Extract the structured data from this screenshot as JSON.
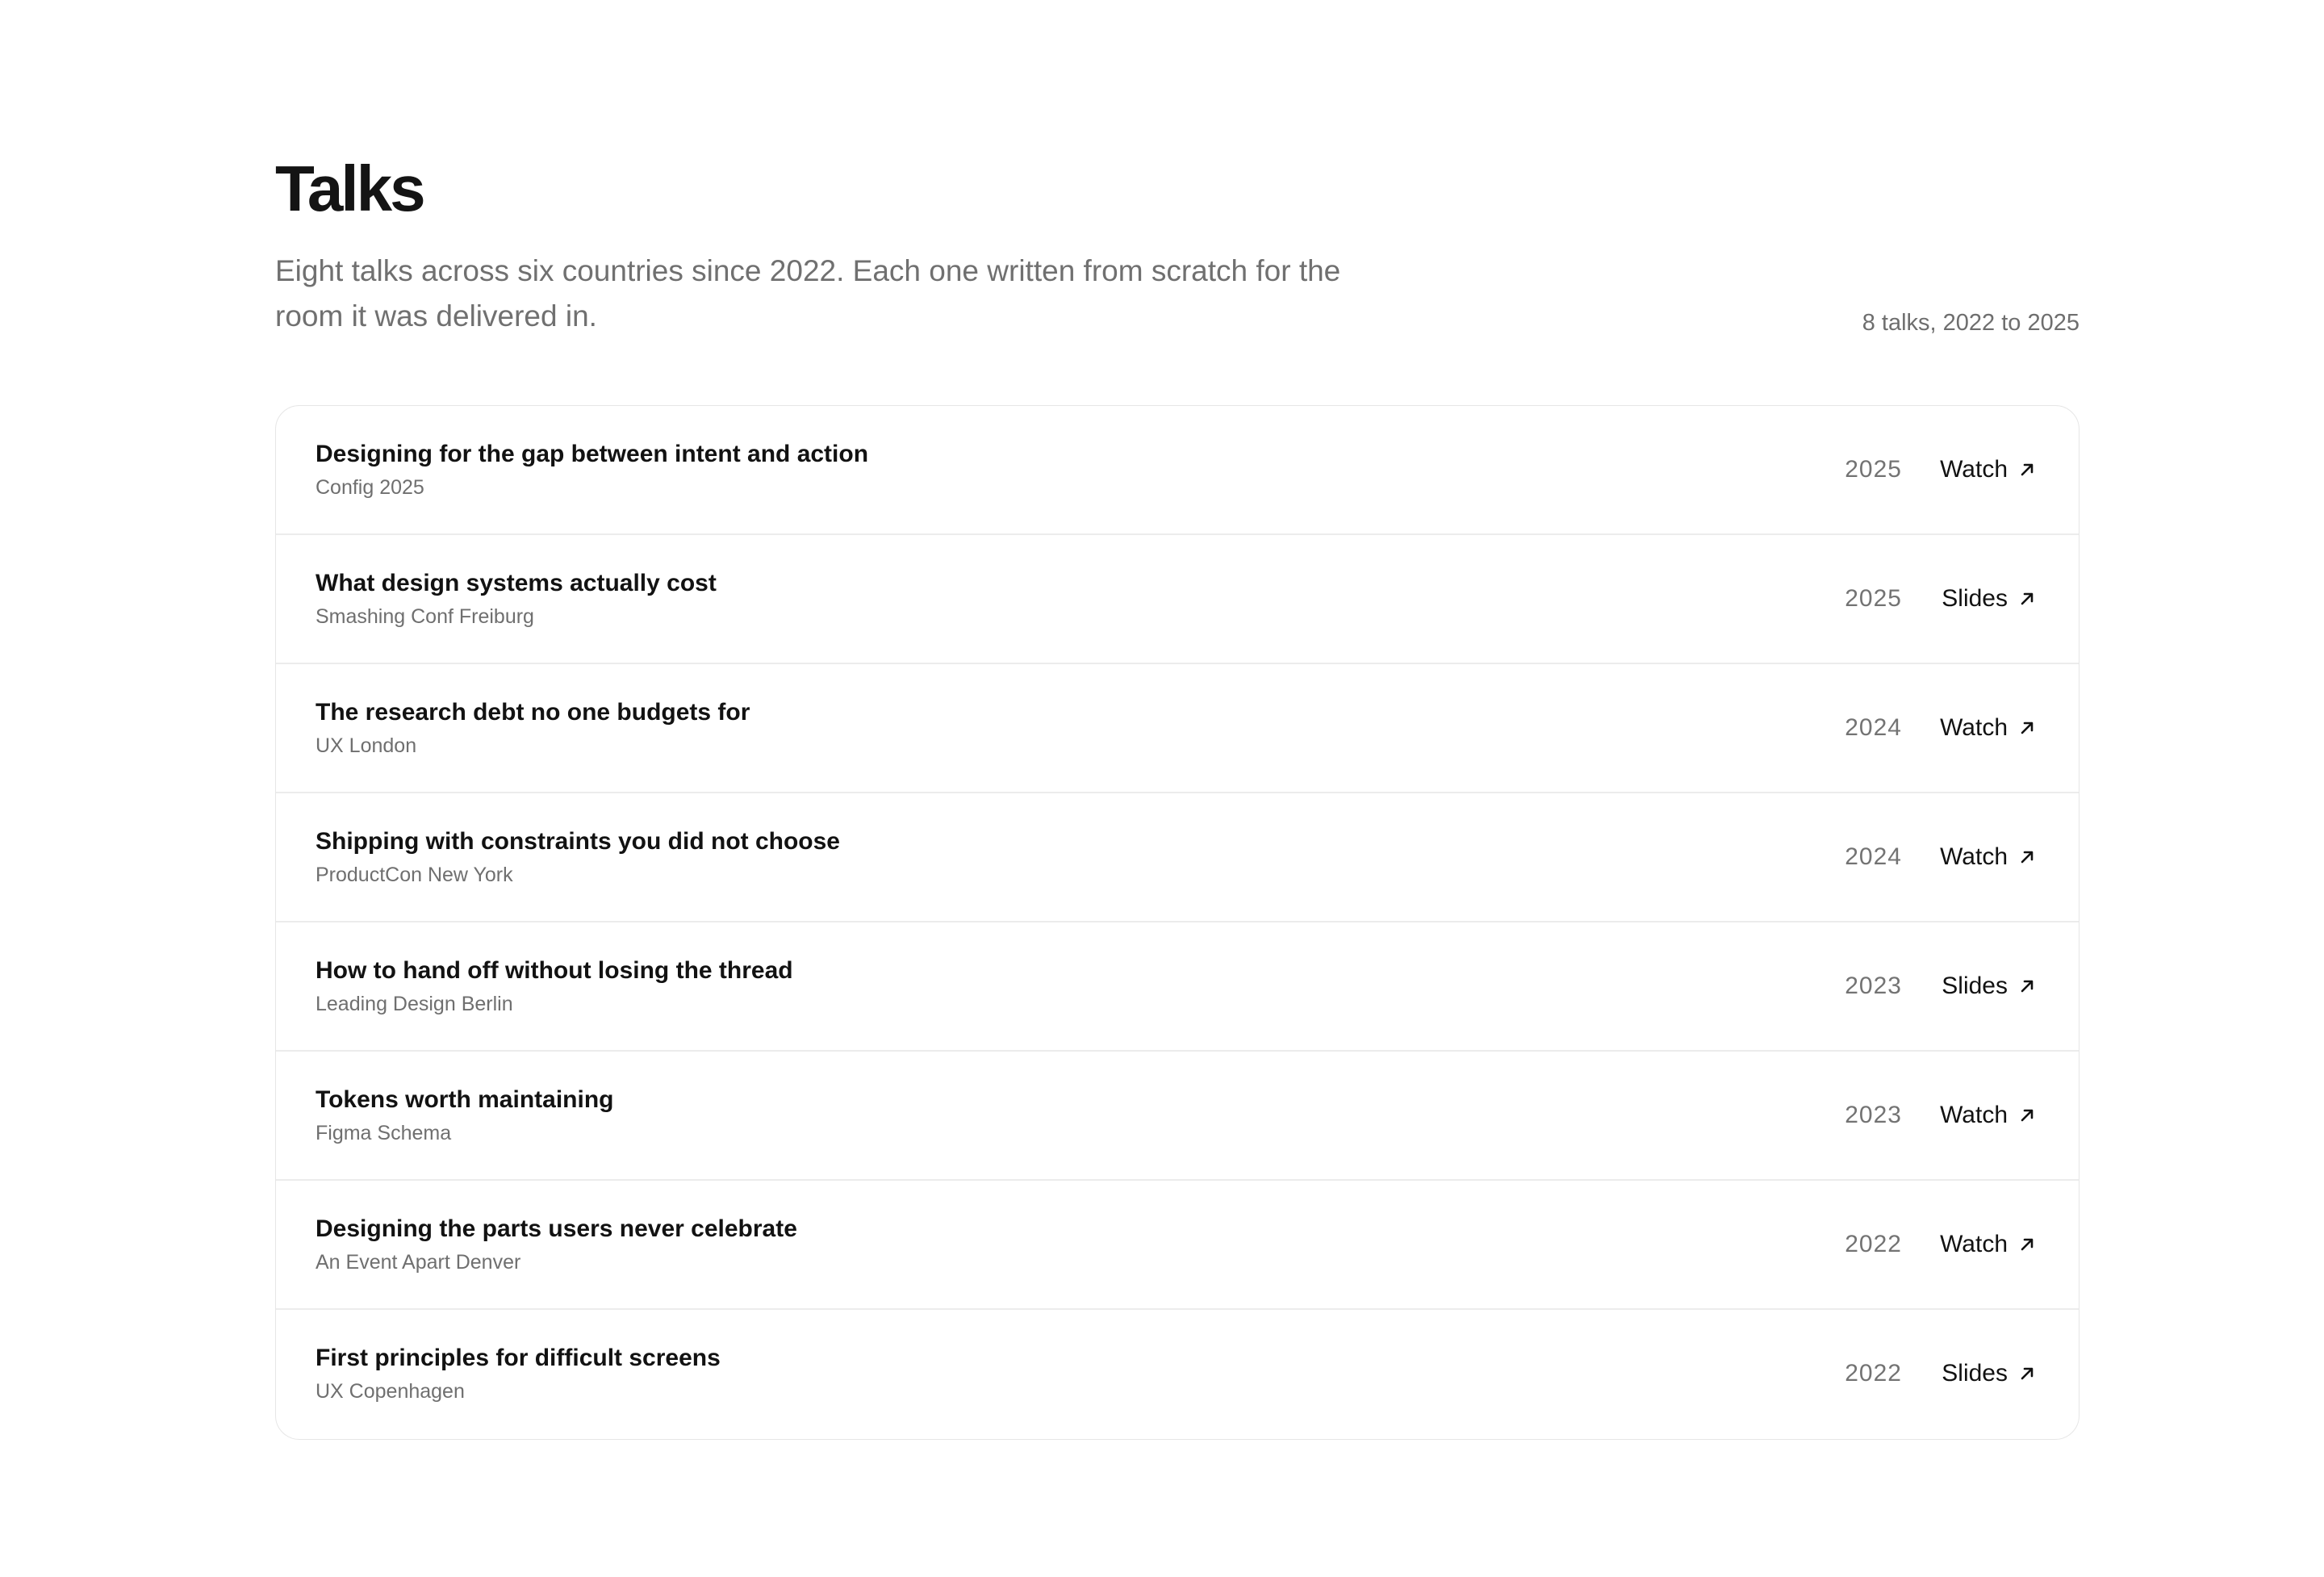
{
  "header": {
    "title": "Talks",
    "intro": "Eight talks across six countries since 2022. Each one written from scratch for the room it was delivered in.",
    "summary": "8 talks, 2022 to 2025"
  },
  "talks": [
    {
      "title": "Designing for the gap between intent and action",
      "event": "Config 2025",
      "year": "2025",
      "link_label": "Watch"
    },
    {
      "title": "What design systems actually cost",
      "event": "Smashing Conf Freiburg",
      "year": "2025",
      "link_label": "Slides"
    },
    {
      "title": "The research debt no one budgets for",
      "event": "UX London",
      "year": "2024",
      "link_label": "Watch"
    },
    {
      "title": "Shipping with constraints you did not choose",
      "event": "ProductCon New York",
      "year": "2024",
      "link_label": "Watch"
    },
    {
      "title": "How to hand off without losing the thread",
      "event": "Leading Design Berlin",
      "year": "2023",
      "link_label": "Slides"
    },
    {
      "title": "Tokens worth maintaining",
      "event": "Figma Schema",
      "year": "2023",
      "link_label": "Watch"
    },
    {
      "title": "Designing the parts users never celebrate",
      "event": "An Event Apart Denver",
      "year": "2022",
      "link_label": "Watch"
    },
    {
      "title": "First principles for difficult screens",
      "event": "UX Copenhagen",
      "year": "2022",
      "link_label": "Slides"
    }
  ],
  "link_icon": "arrow-up-right-icon"
}
